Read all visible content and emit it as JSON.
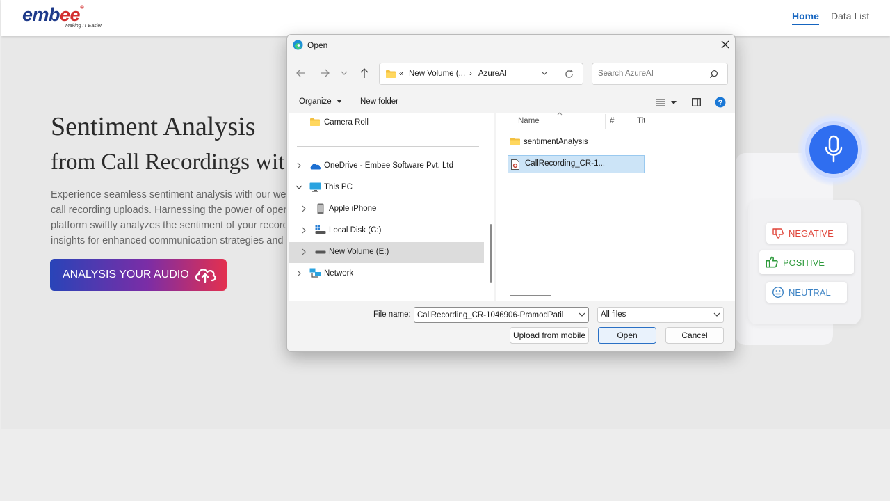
{
  "site": {
    "logo_word_a": "emb",
    "logo_word_b": "ee",
    "logo_reg": "®",
    "logo_tagline": "Making IT Easier",
    "nav": [
      {
        "label": "Home"
      },
      {
        "label": "Data List"
      }
    ],
    "hero": {
      "title": "Sentiment Analysis",
      "subtitle": "from Call Recordings wit",
      "desc_lines": [
        "Experience seamless sentiment analysis with our web",
        "call recording uploads. Harnessing the power of open",
        "platform swiftly analyzes the sentiment of your record",
        "insights for enhanced communication strategies and"
      ],
      "cta_label": "ANALYSIS YOUR AUDIO"
    },
    "sentiments": [
      {
        "label": "NEGATIVE",
        "icon": "thumbs-down-icon",
        "color": "#e0453a"
      },
      {
        "label": "POSITIVE",
        "icon": "thumbs-up-icon",
        "color": "#2e9a3c"
      },
      {
        "label": "NEUTRAL",
        "icon": "neutral-face-icon",
        "color": "#3b82c4"
      }
    ]
  },
  "dialog": {
    "title": "Open",
    "breadcrumb": {
      "overflow": "«",
      "parent": "New Volume (...",
      "separator": "›",
      "current": "AzureAI"
    },
    "search_placeholder": "Search AzureAI",
    "commands": {
      "organize": "Organize",
      "new_folder": "New folder"
    },
    "nav_items": [
      {
        "label": "Camera Roll",
        "icon": "folder-icon"
      },
      {
        "label": "OneDrive - Embee Software Pvt. Ltd",
        "icon": "cloud-icon"
      },
      {
        "label": "This PC",
        "icon": "monitor-icon"
      },
      {
        "label": "Apple iPhone",
        "icon": "phone-icon"
      },
      {
        "label": "Local Disk (C:)",
        "icon": "drive-icon"
      },
      {
        "label": "New Volume (E:)",
        "icon": "drive-icon",
        "selected": true
      },
      {
        "label": "Network",
        "icon": "network-icon"
      }
    ],
    "columns": {
      "name": "Name",
      "number": "#",
      "title": "Tit"
    },
    "files": [
      {
        "name": "sentimentAnalysis",
        "type": "folder"
      },
      {
        "name": "CallRecording_CR-1...",
        "type": "audio-file",
        "selected": true
      }
    ],
    "file_name_label": "File name:",
    "file_name_value": "CallRecording_CR-1046906-PramodPatil",
    "file_type": "All files",
    "buttons": {
      "upload": "Upload from mobile",
      "open": "Open",
      "cancel": "Cancel"
    },
    "accent": "#2a70c5"
  }
}
